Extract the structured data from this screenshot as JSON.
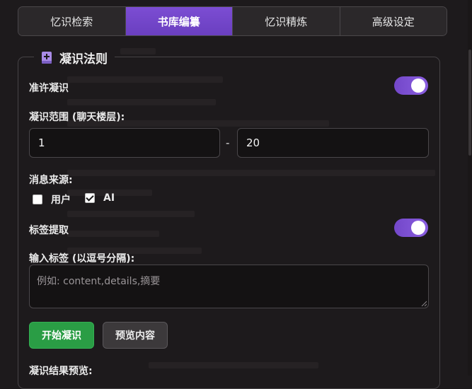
{
  "tabs": [
    {
      "label": "忆识检索",
      "active": false
    },
    {
      "label": "书库编纂",
      "active": true
    },
    {
      "label": "忆识精炼",
      "active": false
    },
    {
      "label": "高级设定",
      "active": false
    }
  ],
  "section": {
    "title": "凝识法则",
    "icon": "book-plus-icon"
  },
  "allow_condense": {
    "label": "准许凝识",
    "enabled": true
  },
  "range": {
    "label": "凝识范围 (聊天楼层):",
    "start": "1",
    "separator": "-",
    "end": "20"
  },
  "source": {
    "label": "消息来源:",
    "options": [
      {
        "label": "用户",
        "checked": false
      },
      {
        "label": "AI",
        "checked": true
      }
    ]
  },
  "tag_extract": {
    "label": "标签提取",
    "enabled": true
  },
  "tags_input": {
    "label": "输入标签 (以逗号分隔):",
    "placeholder": "例如: content,details,摘要",
    "value": ""
  },
  "buttons": {
    "start": "开始凝识",
    "preview": "预览内容"
  },
  "result_label": "凝识结果预览:",
  "colors": {
    "accent": "#7347c9",
    "primary_button": "#2a9d45",
    "background": "#1d1a1c"
  }
}
